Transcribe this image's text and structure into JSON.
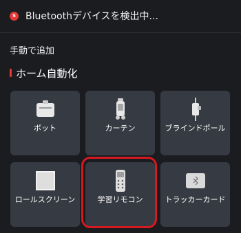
{
  "scan": {
    "icon": "bluetooth-scan-icon",
    "icon_glyph": "S",
    "text": "Bluetoothデバイスを検出中..."
  },
  "manual": {
    "label": "手動で追加"
  },
  "section": {
    "title": "ホーム自動化"
  },
  "tiles": [
    {
      "label": "ボット",
      "icon": "bot-icon"
    },
    {
      "label": "カーテン",
      "icon": "curtain-icon"
    },
    {
      "label": "ブラインドポール",
      "icon": "blind-pole-icon"
    },
    {
      "label": "ロールスクリーン",
      "icon": "roll-screen-icon"
    },
    {
      "label": "学習リモコン",
      "icon": "learning-remote-icon",
      "highlighted": true
    },
    {
      "label": "トラッカーカード",
      "icon": "tracker-card-icon"
    }
  ],
  "colors": {
    "background": "#1a1c20",
    "tile": "#363a42",
    "accent": "#e53935",
    "highlight": "#d71920"
  }
}
